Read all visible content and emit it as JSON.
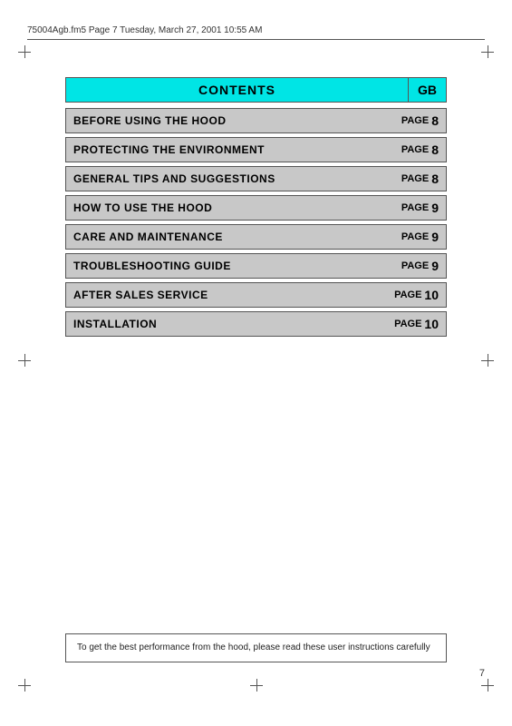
{
  "header": {
    "file_info": "75004Agb.fm5  Page 7  Tuesday, March 27, 2001  10:55 AM"
  },
  "contents": {
    "title": "CONTENTS",
    "gb_label": "GB",
    "rows": [
      {
        "label": "BEFORE USING THE HOOD",
        "page_word": "PAGE",
        "page_num": "8"
      },
      {
        "label": "PROTECTING THE ENVIRONMENT",
        "page_word": "PAGE",
        "page_num": "8"
      },
      {
        "label": "GENERAL TIPS AND SUGGESTIONS",
        "page_word": "PAGE",
        "page_num": "8"
      },
      {
        "label": "HOW TO USE THE HOOD",
        "page_word": "PAGE",
        "page_num": "9"
      },
      {
        "label": "CARE AND MAINTENANCE",
        "page_word": "PAGE",
        "page_num": "9"
      },
      {
        "label": "TROUBLESHOOTING GUIDE",
        "page_word": "PAGE",
        "page_num": "9"
      },
      {
        "label": "AFTER SALES SERVICE",
        "page_word": "PAGE",
        "page_num": "10"
      },
      {
        "label": "INSTALLATION",
        "page_word": "PAGE",
        "page_num": "10"
      }
    ]
  },
  "bottom_notice": "To get the best performance from the hood, please read these user instructions carefully",
  "page_number": "7"
}
